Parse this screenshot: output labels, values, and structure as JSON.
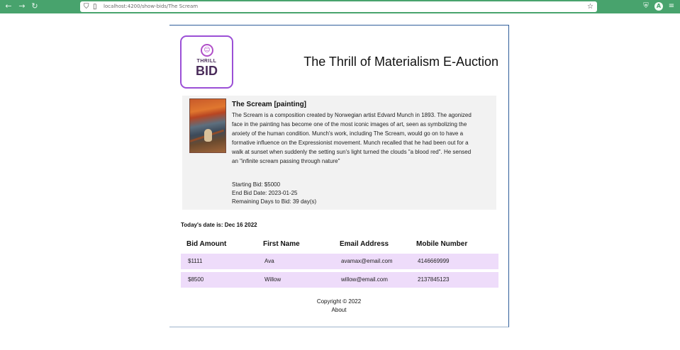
{
  "browser": {
    "back_icon": "back-arrow-icon",
    "forward_icon": "forward-arrow-icon",
    "reload_icon": "reload-icon",
    "url": "localhost:4200/show-bids/The Scream",
    "bookmark_icon": "star-icon",
    "profile_initial": "A",
    "accent": "#48a36d"
  },
  "site": {
    "title": "The Thrill of Materialism E-Auction",
    "logo": {
      "line1": "THRILL",
      "line2": "BID",
      "color": "#9b4fd6"
    }
  },
  "artwork": {
    "title": "The Scream [painting]",
    "description": "The Scream is a composition created by Norwegian artist Edvard Munch in 1893. The agonized face in the painting has become one of the most iconic images of art, seen as symbolizing the anxiety of the human condition. Munch's work, including The Scream, would go on to have a formative influence on the Expressionist movement. Munch recalled that he had been out for a walk at sunset when suddenly the setting sun's light turned the clouds \"a blood red\". He sensed an \"infinite scream passing through nature\"",
    "starting_bid": "Starting Bid: $5000",
    "end_date": "End Bid Date: 2023-01-25",
    "remaining_days": "Remaining Days to Bid: 39 day(s)"
  },
  "today": "Today's date is: Dec 16 2022",
  "bids": {
    "headers": [
      "Bid Amount",
      "First Name",
      "Email Address",
      "Mobile Number"
    ],
    "rows": [
      [
        "$1111",
        "Ava",
        "avamax@email.com",
        "4146669999"
      ],
      [
        "$8500",
        "Willow",
        "willow@email.com",
        "2137845123"
      ]
    ],
    "row_color": "#eedcfa"
  },
  "footer": {
    "copyright": "Copyright © 2022",
    "about": "About"
  }
}
